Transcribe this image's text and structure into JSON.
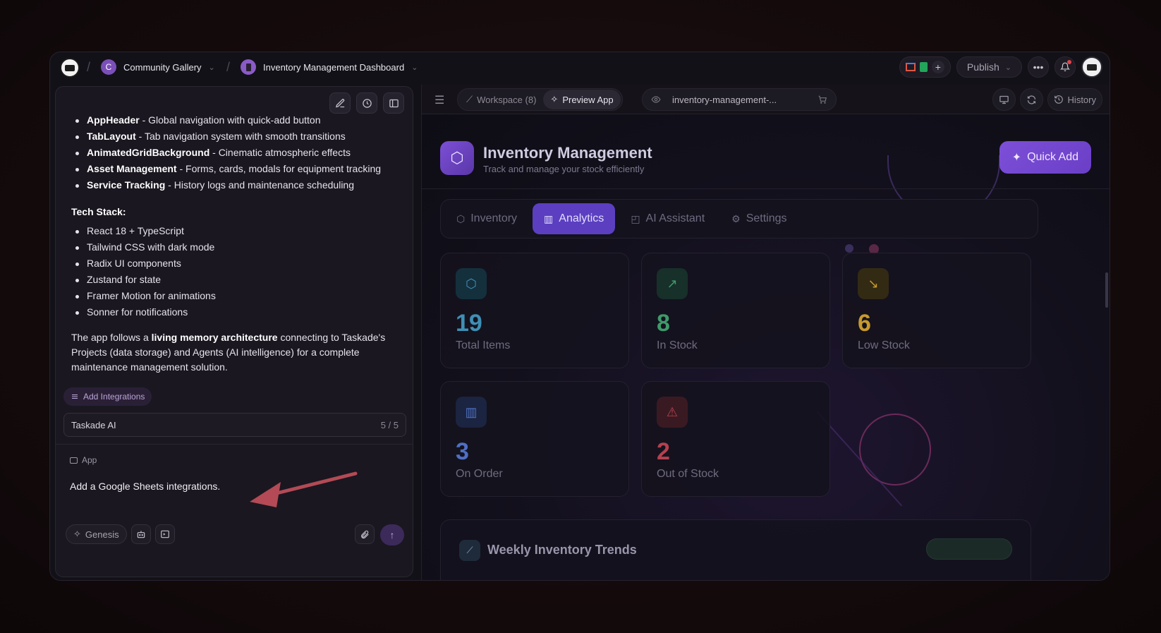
{
  "breadcrumb": {
    "workspace": "Community Gallery",
    "workspace_initial": "C",
    "project": "Inventory Management Dashboard"
  },
  "topbar": {
    "publish_label": "Publish",
    "more_icon": "ellipsis-icon",
    "bell_icon": "bell-icon"
  },
  "chat": {
    "components": [
      {
        "name": "AppHeader",
        "desc": " - Global navigation with quick-add button"
      },
      {
        "name": "TabLayout",
        "desc": " - Tab navigation system with smooth transitions"
      },
      {
        "name": "AnimatedGridBackground",
        "desc": " - Cinematic atmospheric effects"
      },
      {
        "name": "Asset Management",
        "desc": " - Forms, cards, modals for equipment tracking"
      },
      {
        "name": "Service Tracking",
        "desc": " - History logs and maintenance scheduling"
      }
    ],
    "tech_heading": "Tech Stack:",
    "tech_stack": [
      "React 18 + TypeScript",
      "Tailwind CSS with dark mode",
      "Radix UI components",
      "Zustand for state",
      "Framer Motion for animations",
      "Sonner for notifications"
    ],
    "summary_pre": "The app follows a ",
    "summary_bold": "living memory architecture",
    "summary_post": " connecting to Taskade's Projects (data storage) and Agents (AI intelligence) for a complete maintenance management solution.",
    "add_integrations": "Add Integrations",
    "agent_name": "Taskade AI",
    "agent_count": "5 / 5",
    "mode_chip": "App",
    "prompt_text": "Add a Google Sheets integrations.",
    "genesis_label": "Genesis"
  },
  "preview": {
    "workspace_label": "Workspace (8)",
    "preview_label": "Preview App",
    "url_text": "inventory-management-...",
    "history_label": "History"
  },
  "app": {
    "title": "Inventory Management",
    "subtitle": "Track and manage your stock efficiently",
    "quick_add": "Quick Add",
    "tabs": [
      {
        "label": "Inventory",
        "icon": "cube-icon"
      },
      {
        "label": "Analytics",
        "icon": "bar-chart-icon",
        "active": true
      },
      {
        "label": "AI Assistant",
        "icon": "robot-icon"
      },
      {
        "label": "Settings",
        "icon": "gear-icon"
      }
    ],
    "stats": [
      {
        "value": "19",
        "label": "Total Items",
        "color": "#3f8fb5",
        "icon": "cube-icon"
      },
      {
        "value": "8",
        "label": "In Stock",
        "color": "#3f9a6a",
        "icon": "trend-up-icon"
      },
      {
        "value": "6",
        "label": "Low Stock",
        "color": "#c89a2b",
        "icon": "trend-down-icon"
      },
      {
        "value": "3",
        "label": "On Order",
        "color": "#4f6fc2",
        "icon": "bar-chart-icon"
      },
      {
        "value": "2",
        "label": "Out of Stock",
        "color": "#b3414f",
        "icon": "warning-icon"
      }
    ],
    "weekly_title": "Weekly Inventory Trends"
  },
  "colors": {
    "accent": "#5b3fc0",
    "window_bg": "#131118",
    "arrow": "#b34a55"
  }
}
